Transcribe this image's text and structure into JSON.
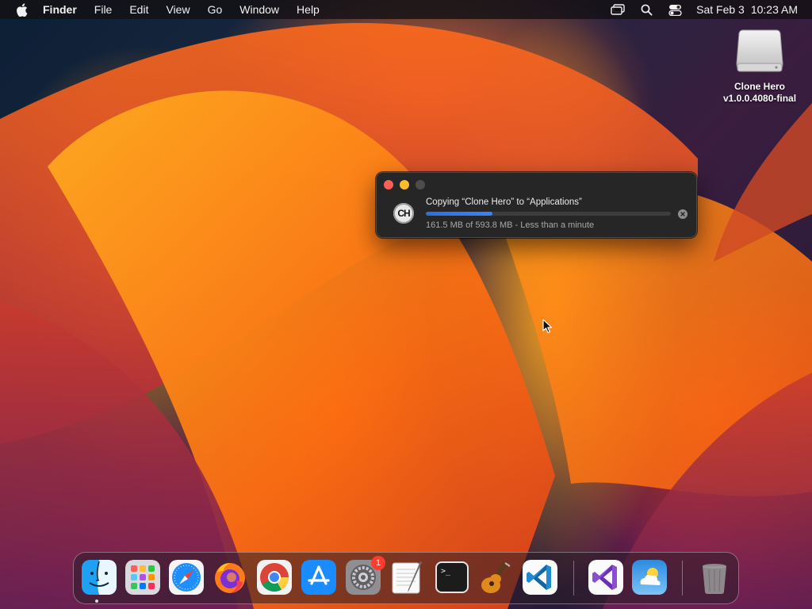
{
  "menubar": {
    "app_name": "Finder",
    "items": [
      "File",
      "Edit",
      "View",
      "Go",
      "Window",
      "Help"
    ],
    "date": "Sat Feb 3",
    "time": "10:23 AM",
    "status_icons": [
      "screen-mirroring-icon",
      "spotlight-search-icon",
      "control-center-icon"
    ]
  },
  "desktop": {
    "disk": {
      "line1": "Clone Hero",
      "line2": "v1.0.0.4080-final",
      "icon": "disk-image-icon"
    }
  },
  "copy_dialog": {
    "title": "Copying “Clone Hero” to “Applications”",
    "status": "161.5 MB of 593.8 MB - Less than a minute",
    "app_icon_text": "CH",
    "progress_fraction": 0.272,
    "colors": {
      "close": "#fe5f57",
      "minimize": "#febc2e",
      "progress": "#3a83f5"
    }
  },
  "dock": {
    "apps": [
      {
        "name": "finder-icon",
        "running": true
      },
      {
        "name": "launchpad-icon"
      },
      {
        "name": "safari-icon"
      },
      {
        "name": "firefox-icon"
      },
      {
        "name": "chrome-icon"
      },
      {
        "name": "app-store-icon"
      },
      {
        "name": "system-settings-icon",
        "badge": "1"
      },
      {
        "name": "textedit-icon"
      },
      {
        "name": "terminal-icon"
      },
      {
        "name": "garageband-icon"
      },
      {
        "name": "vscode-icon"
      },
      {
        "name": "visual-studio-icon"
      },
      {
        "name": "weather-icon"
      },
      {
        "name": "trash-icon"
      }
    ]
  }
}
